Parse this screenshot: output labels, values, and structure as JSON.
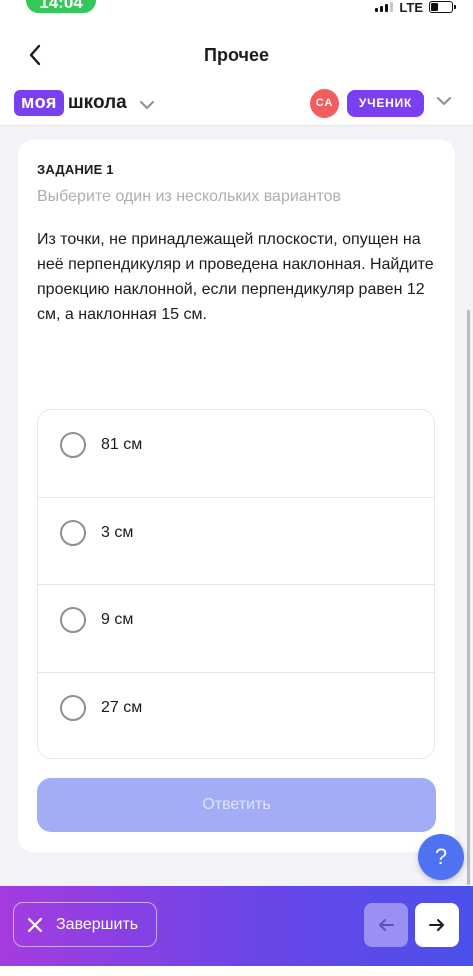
{
  "status_bar": {
    "time": "14:04",
    "network": "LTE"
  },
  "header": {
    "title": "Прочее"
  },
  "brand": {
    "part1": "моя",
    "part2": "школа"
  },
  "user": {
    "initials": "СА",
    "role": "УЧЕНИК"
  },
  "task": {
    "number_label": "ЗАДАНИЕ 1",
    "hint": "Выберите один из нескольких вариантов",
    "question": "Из точки, не принадлежащей плоскости, опущен на неё перпендикуляр и проведена наклонная. Найдите проекцию наклонной, если перпендикуляр равен 12 см, а наклонная 15 см.",
    "options": [
      "81 см",
      "3 см",
      "9 см",
      "27 см"
    ],
    "submit_label": "Ответить"
  },
  "help": {
    "label": "?"
  },
  "bottom_bar": {
    "finish_label": "Завершить"
  },
  "colors": {
    "accent": "#7b3ff2",
    "avatar": "#f25d5d",
    "submit_disabled": "#a3acf7",
    "help": "#4f72f2"
  },
  "icons": [
    "back-chevron-icon",
    "chevron-down-icon",
    "close-icon",
    "arrow-left-icon",
    "arrow-right-icon"
  ]
}
